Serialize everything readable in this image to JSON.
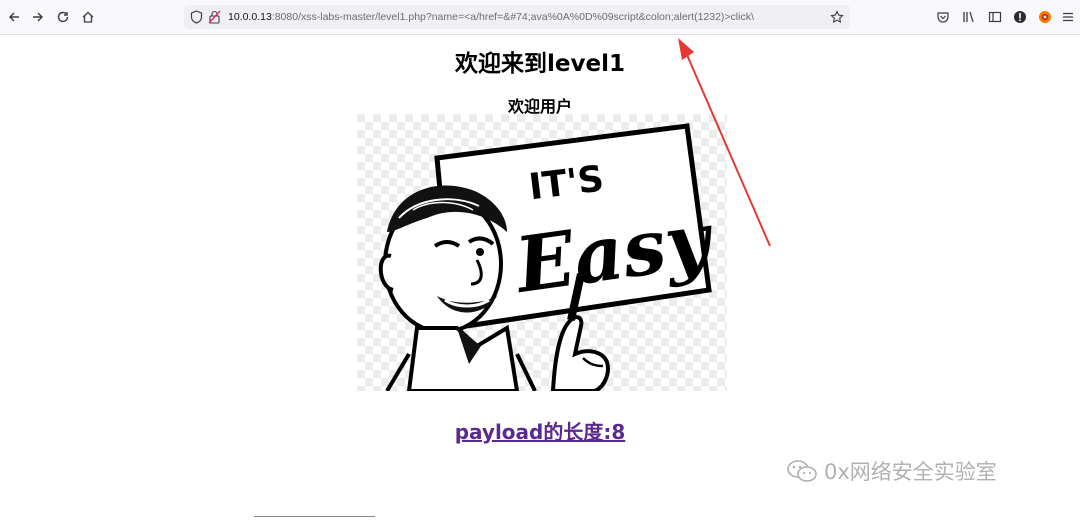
{
  "browser": {
    "url_host": "10.0.0.13",
    "url_rest": ":8080/xss-labs-master/level1.php?name=<a/href=&#74;ava%0A%0D%09script&colon;alert(1232)>click\\"
  },
  "page": {
    "heading": "欢迎来到level1",
    "subheading": "欢迎用户",
    "image": {
      "top_text": "IT'S",
      "main_text": "Easy"
    },
    "payload_link": "payload的长度:8"
  },
  "watermark": {
    "text": "0x网络安全实验室"
  }
}
